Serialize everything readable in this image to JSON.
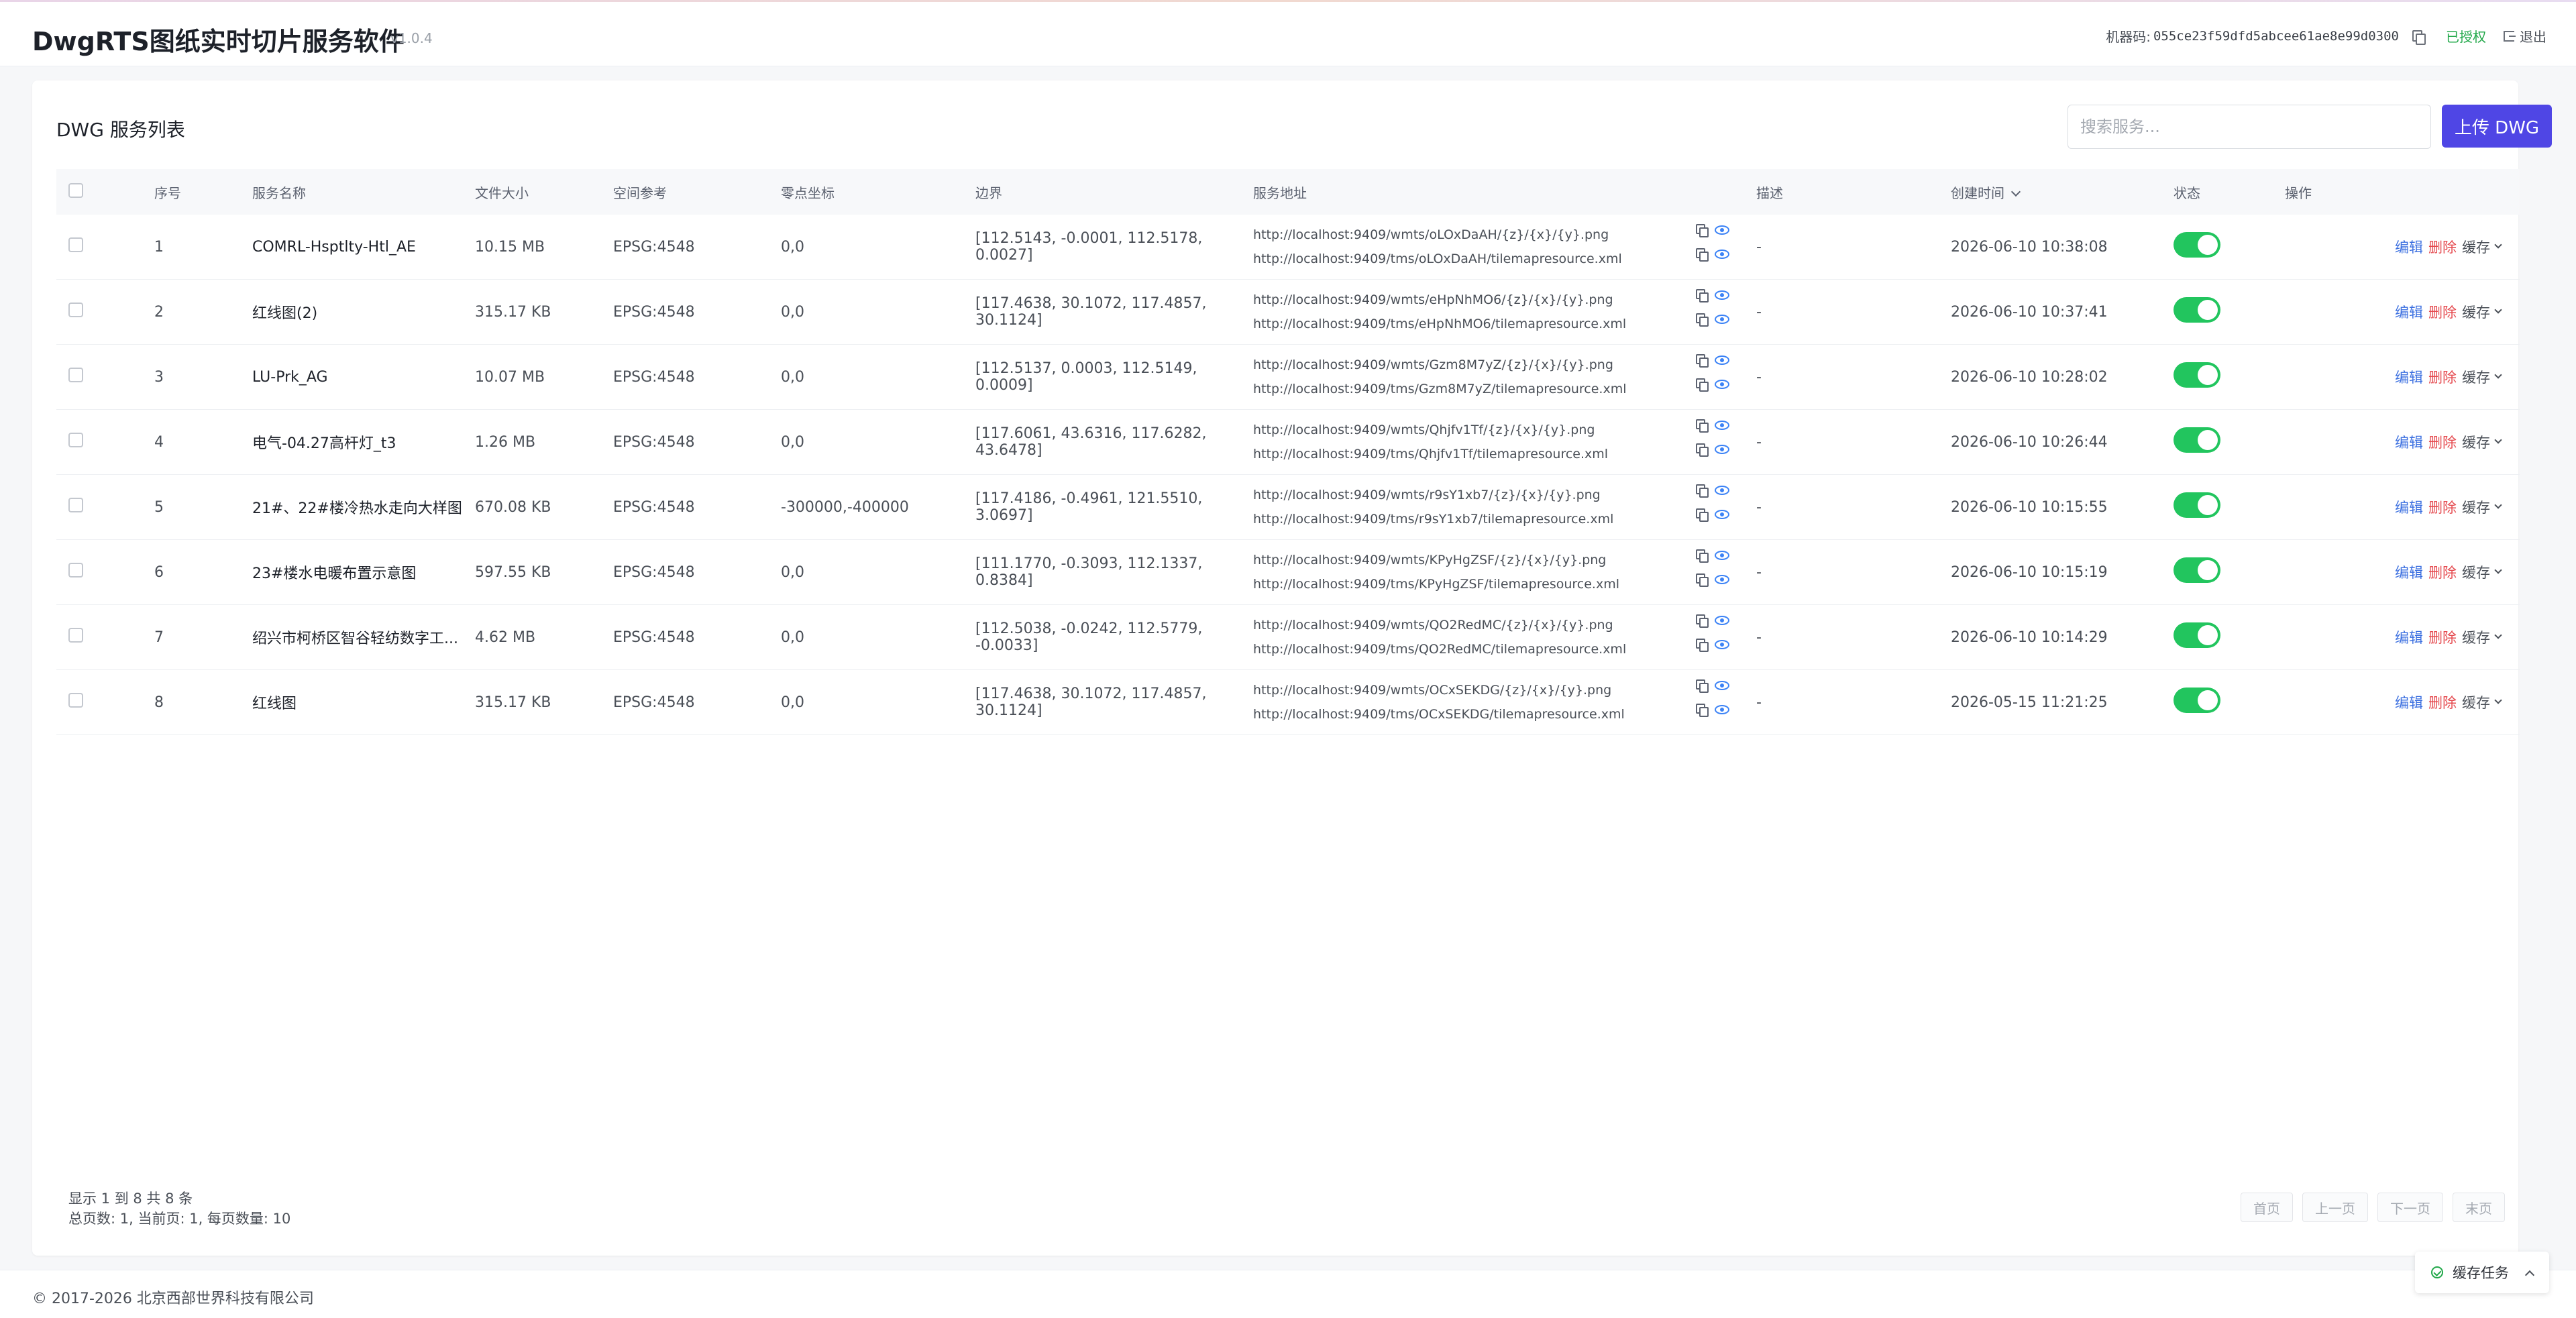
{
  "header": {
    "title": "DwgRTS图纸实时切片服务软件",
    "version": "v1.0.4",
    "machine_label": "机器码:",
    "machine_code": "055ce23f59dfd5abcee61ae8e99d0300",
    "license_status": "已授权",
    "logout_label": "退出"
  },
  "main": {
    "title": "DWG 服务列表",
    "search_placeholder": "搜索服务...",
    "upload_label": "上传 DWG"
  },
  "table": {
    "columns": {
      "idx": "序号",
      "name": "服务名称",
      "size": "文件大小",
      "sref": "空间参考",
      "zero": "零点坐标",
      "bound": "边界",
      "url": "服务地址",
      "desc": "描述",
      "time": "创建时间",
      "status": "状态",
      "ops": "操作"
    },
    "rows": [
      {
        "idx": "1",
        "name": "COMRL-Hsptlty-Htl_AE",
        "size": "10.15 MB",
        "sref": "EPSG:4548",
        "zero": "0,0",
        "bound": "[112.5143, -0.0001, 112.5178, 0.0027]",
        "url1": "http://localhost:9409/wmts/oLOxDaAH/{z}/{x}/{y}.png",
        "url2": "http://localhost:9409/tms/oLOxDaAH/tilemapresource.xml",
        "desc": "-",
        "time": "2026-06-10 10:38:08",
        "edit": "编辑",
        "del": "删除",
        "cache": "缓存"
      },
      {
        "idx": "2",
        "name": "红线图(2)",
        "size": "315.17 KB",
        "sref": "EPSG:4548",
        "zero": "0,0",
        "bound": "[117.4638, 30.1072, 117.4857, 30.1124]",
        "url1": "http://localhost:9409/wmts/eHpNhMO6/{z}/{x}/{y}.png",
        "url2": "http://localhost:9409/tms/eHpNhMO6/tilemapresource.xml",
        "desc": "-",
        "time": "2026-06-10 10:37:41",
        "edit": "编辑",
        "del": "删除",
        "cache": "缓存"
      },
      {
        "idx": "3",
        "name": "LU-Prk_AG",
        "size": "10.07 MB",
        "sref": "EPSG:4548",
        "zero": "0,0",
        "bound": "[112.5137, 0.0003, 112.5149, 0.0009]",
        "url1": "http://localhost:9409/wmts/Gzm8M7yZ/{z}/{x}/{y}.png",
        "url2": "http://localhost:9409/tms/Gzm8M7yZ/tilemapresource.xml",
        "desc": "-",
        "time": "2026-06-10 10:28:02",
        "edit": "编辑",
        "del": "删除",
        "cache": "缓存"
      },
      {
        "idx": "4",
        "name": "电气-04.27高杆灯_t3",
        "size": "1.26 MB",
        "sref": "EPSG:4548",
        "zero": "0,0",
        "bound": "[117.6061, 43.6316, 117.6282, 43.6478]",
        "url1": "http://localhost:9409/wmts/Qhjfv1Tf/{z}/{x}/{y}.png",
        "url2": "http://localhost:9409/tms/Qhjfv1Tf/tilemapresource.xml",
        "desc": "-",
        "time": "2026-06-10 10:26:44",
        "edit": "编辑",
        "del": "删除",
        "cache": "缓存"
      },
      {
        "idx": "5",
        "name": "21#、22#楼冷热水走向大样图",
        "size": "670.08 KB",
        "sref": "EPSG:4548",
        "zero": "-300000,-400000",
        "bound": "[117.4186, -0.4961, 121.5510, 3.0697]",
        "url1": "http://localhost:9409/wmts/r9sY1xb7/{z}/{x}/{y}.png",
        "url2": "http://localhost:9409/tms/r9sY1xb7/tilemapresource.xml",
        "desc": "-",
        "time": "2026-06-10 10:15:55",
        "edit": "编辑",
        "del": "删除",
        "cache": "缓存"
      },
      {
        "idx": "6",
        "name": "23#楼水电暖布置示意图",
        "size": "597.55 KB",
        "sref": "EPSG:4548",
        "zero": "0,0",
        "bound": "[111.1770, -0.3093, 112.1337, 0.8384]",
        "url1": "http://localhost:9409/wmts/KPyHgZSF/{z}/{x}/{y}.png",
        "url2": "http://localhost:9409/tms/KPyHgZSF/tilemapresource.xml",
        "desc": "-",
        "time": "2026-06-10 10:15:19",
        "edit": "编辑",
        "del": "删除",
        "cache": "缓存"
      },
      {
        "idx": "7",
        "name": "绍兴市柯桥区智谷轻纺数字工...",
        "size": "4.62 MB",
        "sref": "EPSG:4548",
        "zero": "0,0",
        "bound": "[112.5038, -0.0242, 112.5779, -0.0033]",
        "url1": "http://localhost:9409/wmts/QO2RedMC/{z}/{x}/{y}.png",
        "url2": "http://localhost:9409/tms/QO2RedMC/tilemapresource.xml",
        "desc": "-",
        "time": "2026-06-10 10:14:29",
        "edit": "编辑",
        "del": "删除",
        "cache": "缓存"
      },
      {
        "idx": "8",
        "name": "红线图",
        "size": "315.17 KB",
        "sref": "EPSG:4548",
        "zero": "0,0",
        "bound": "[117.4638, 30.1072, 117.4857, 30.1124]",
        "url1": "http://localhost:9409/wmts/OCxSEKDG/{z}/{x}/{y}.png",
        "url2": "http://localhost:9409/tms/OCxSEKDG/tilemapresource.xml",
        "desc": "-",
        "time": "2026-05-15 11:21:25",
        "edit": "编辑",
        "del": "删除",
        "cache": "缓存"
      }
    ]
  },
  "pagination": {
    "summary": "显示 1 到 8 共 8 条",
    "detail": "总页数: 1, 当前页: 1, 每页数量: 10",
    "first": "首页",
    "prev": "上一页",
    "next": "下一页",
    "last": "末页"
  },
  "footer": {
    "copyright": "© 2017-2026 北京西部世界科技有限公司",
    "task_label": "缓存任务"
  },
  "colors": {
    "primary": "#4f46e5",
    "success": "#22c55e",
    "danger": "#e5484d",
    "link": "#3b6fe0"
  }
}
